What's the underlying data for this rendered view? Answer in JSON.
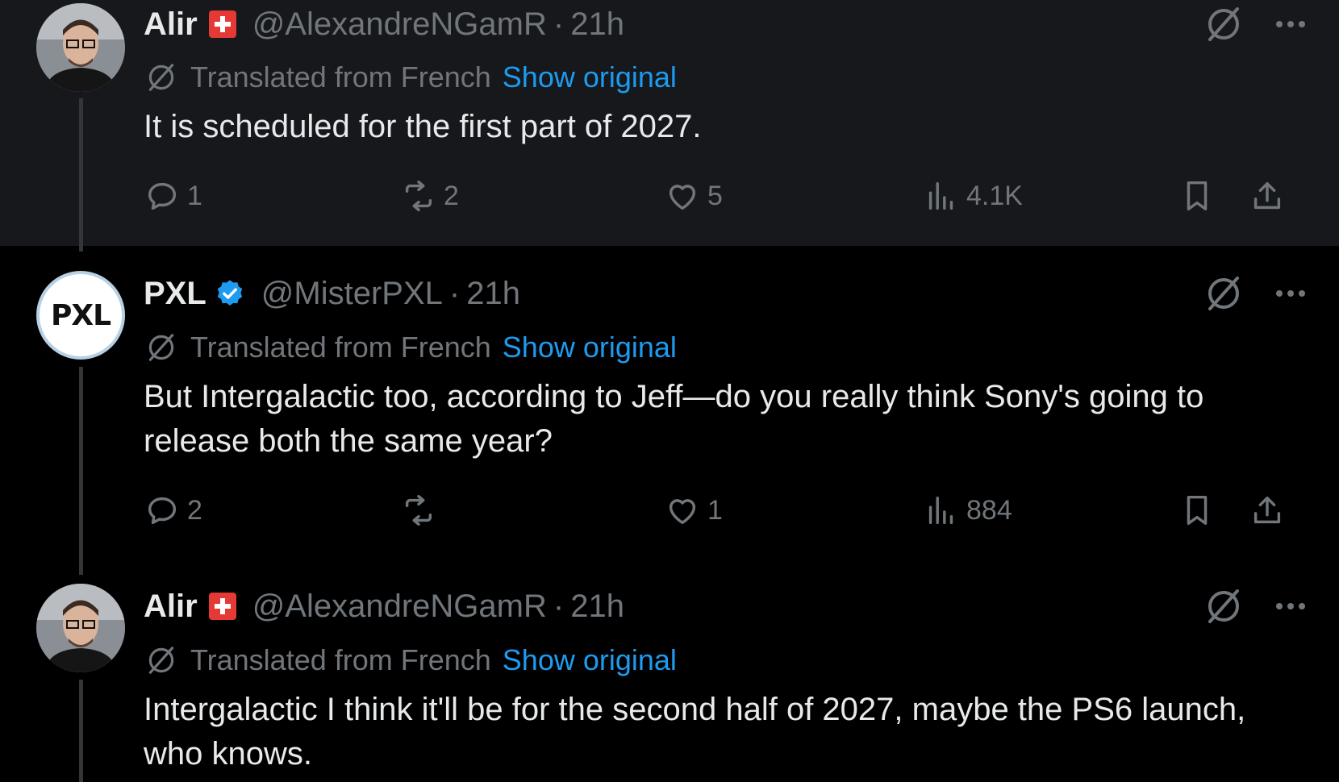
{
  "translation": {
    "label": "Translated from French",
    "show_original": "Show original"
  },
  "tweets": [
    {
      "name": "Alir",
      "handle": "@AlexandreNGamR",
      "separator": "·",
      "time": "21h",
      "text": "It is scheduled for the first part of 2027.",
      "stats": {
        "replies": "1",
        "reposts": "2",
        "likes": "5",
        "views": "4.1K"
      },
      "avatar": "user-photo"
    },
    {
      "name": "PXL",
      "handle": "@MisterPXL",
      "separator": "·",
      "time": "21h",
      "text": "But Intergalactic too, according to Jeff—do you really think Sony's going to release both the same year?",
      "stats": {
        "replies": "2",
        "reposts": "",
        "likes": "1",
        "views": "884"
      },
      "avatar_text": "PXL"
    },
    {
      "name": "Alir",
      "handle": "@AlexandreNGamR",
      "separator": "·",
      "time": "21h",
      "text": "Intergalactic I think it'll be for the second half of 2027, maybe the PS6 launch, who knows.",
      "avatar": "user-photo"
    }
  ],
  "colors": {
    "background": "#000000",
    "highlight_background": "#16181c",
    "text": "#e7e9ea",
    "muted": "#71767b",
    "link": "#1d9bf0",
    "verified": "#1d9bf0",
    "flag": "#e53935"
  },
  "icons": [
    "translate-icon",
    "more-icon",
    "reply-icon",
    "repost-icon",
    "like-icon",
    "views-icon",
    "bookmark-icon",
    "share-icon",
    "verified-badge-icon",
    "swiss-flag-icon"
  ]
}
